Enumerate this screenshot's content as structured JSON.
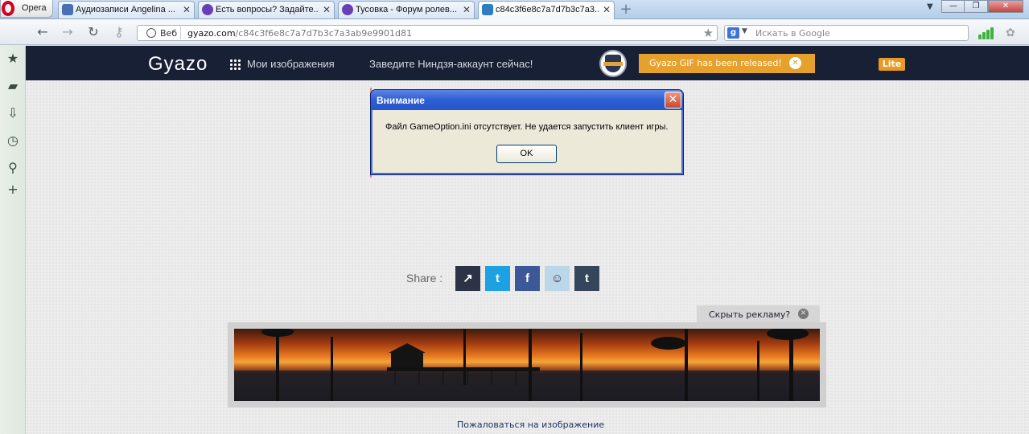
{
  "browser": {
    "menu_label": "Opera",
    "tabs": [
      {
        "title": "Аудиозаписи Angelina ...",
        "favicon_color": "#4a6fb5"
      },
      {
        "title": "Есть вопросы? Задайте...",
        "favicon_color": "#6a3fb5"
      },
      {
        "title": "Тусовка - Форум ролев...",
        "favicon_color": "#6a3fb5"
      },
      {
        "title": "c84c3f6e8c7a7d7b3c7a3...",
        "favicon_color": "#2e7cc4"
      }
    ],
    "window_controls": {
      "minimize": "—",
      "maximize": "❐",
      "close": "✕"
    },
    "address": {
      "web_label": "Веб",
      "url_host": "gyazo.com",
      "url_path": "/c84c3f6e8c7a7d7b3c7a3ab9e9901d81"
    },
    "search": {
      "engine_icon": "g",
      "placeholder": "Искать в Google"
    }
  },
  "sidebar_icons": [
    "star-icon",
    "notes-icon",
    "downloads-icon",
    "history-icon",
    "search-icon",
    "add-icon"
  ],
  "gyazo": {
    "logo": "Gyazo",
    "my_images": "Мои изображения",
    "ninja_promo": "Заведите Ниндзя-аккаунт сейчас!",
    "gif_banner": "Gyazo GIF has been released!",
    "lite_badge": "Lite",
    "colors": {
      "header": "#182036",
      "accent": "#e5a12c"
    }
  },
  "dialog": {
    "title": "Внимание",
    "message": "Файл GameOption.ini отсутствует. Не удается запустить клиент игры.",
    "ok_label": "OK",
    "close_label": "✕"
  },
  "share": {
    "label": "Share :",
    "buttons": [
      {
        "name": "share",
        "glyph": "↗",
        "color": "#2c3346"
      },
      {
        "name": "twitter",
        "glyph": "t",
        "color": "#1da1e2"
      },
      {
        "name": "facebook",
        "glyph": "f",
        "color": "#3b5998"
      },
      {
        "name": "reddit",
        "glyph": "☺",
        "color": "#bcd6ea"
      },
      {
        "name": "tumblr",
        "glyph": "t",
        "color": "#35465c"
      }
    ]
  },
  "ad": {
    "hide_label": "Скрыть рекламу?",
    "close_label": "✕"
  },
  "report_link": "Пожаловаться на изображение"
}
